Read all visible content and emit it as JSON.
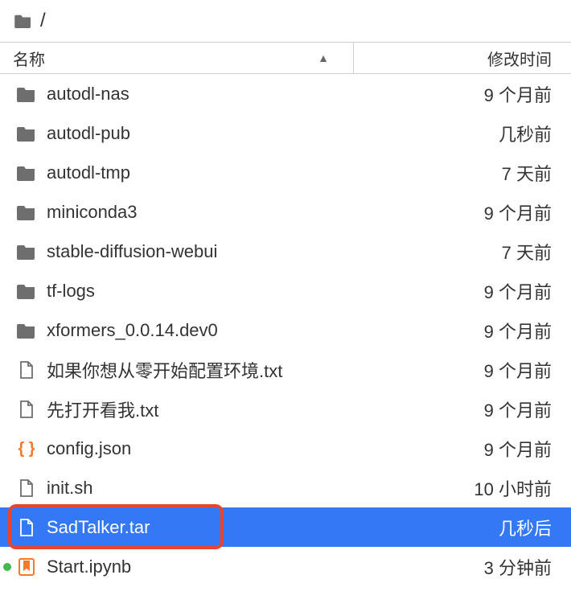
{
  "breadcrumb": {
    "path": "/"
  },
  "columns": {
    "name": "名称",
    "modified": "修改时间"
  },
  "files": [
    {
      "icon": "folder",
      "name": "autodl-nas",
      "time": "9 个月前",
      "selected": false,
      "status": null
    },
    {
      "icon": "folder",
      "name": "autodl-pub",
      "time": "几秒前",
      "selected": false,
      "status": null
    },
    {
      "icon": "folder",
      "name": "autodl-tmp",
      "time": "7 天前",
      "selected": false,
      "status": null
    },
    {
      "icon": "folder",
      "name": "miniconda3",
      "time": "9 个月前",
      "selected": false,
      "status": null
    },
    {
      "icon": "folder",
      "name": "stable-diffusion-webui",
      "time": "7 天前",
      "selected": false,
      "status": null
    },
    {
      "icon": "folder",
      "name": "tf-logs",
      "time": "9 个月前",
      "selected": false,
      "status": null
    },
    {
      "icon": "folder",
      "name": "xformers_0.0.14.dev0",
      "time": "9 个月前",
      "selected": false,
      "status": null
    },
    {
      "icon": "file",
      "name": "如果你想从零开始配置环境.txt",
      "time": "9 个月前",
      "selected": false,
      "status": null
    },
    {
      "icon": "file",
      "name": "先打开看我.txt",
      "time": "9 个月前",
      "selected": false,
      "status": null
    },
    {
      "icon": "json",
      "name": "config.json",
      "time": "9 个月前",
      "selected": false,
      "status": null
    },
    {
      "icon": "file",
      "name": "init.sh",
      "time": "10 小时前",
      "selected": false,
      "status": null
    },
    {
      "icon": "file",
      "name": "SadTalker.tar",
      "time": "几秒后",
      "selected": true,
      "status": null,
      "highlight": true
    },
    {
      "icon": "notebook",
      "name": "Start.ipynb",
      "time": "3 分钟前",
      "selected": false,
      "status": "running"
    }
  ]
}
